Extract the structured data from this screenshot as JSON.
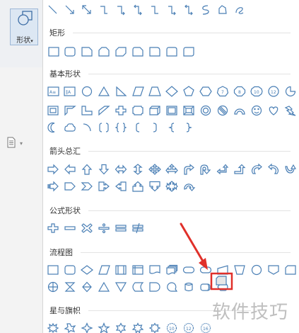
{
  "toolbar": {
    "shape_button_label": "形状",
    "dropdown_caret": "▾"
  },
  "sections": {
    "rectangle": "矩形",
    "basic": "基本形状",
    "arrows": "箭头总汇",
    "equation": "公式形状",
    "flowchart": "流程图",
    "stars": "星与旗帜"
  },
  "basic_shape_text": {
    "textbox": "A≡",
    "vtextbox": "‖A",
    "oct7": "7",
    "oct8": "8",
    "oct10": "10",
    "oct12": "12"
  },
  "star_shape_text": [
    "10",
    "12",
    "16"
  ],
  "watermark": "软件技巧",
  "colors": {
    "shape_stroke": "#4a7fb5",
    "highlight": "#e0302a",
    "button_bg": "#dce7f3"
  }
}
